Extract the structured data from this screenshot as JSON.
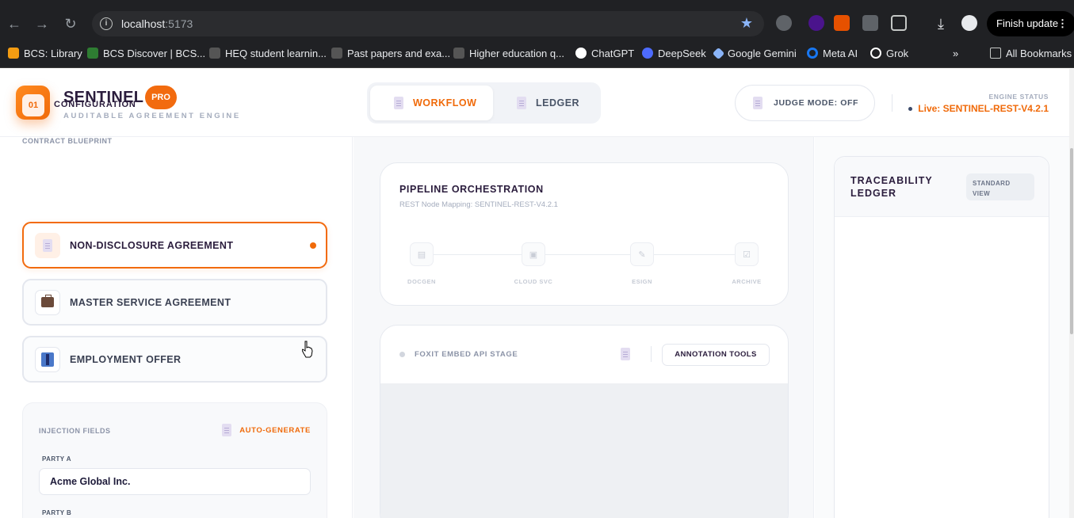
{
  "browser": {
    "url_host": "localhost",
    "url_port": ":5173",
    "finish_update_label": "Finish update",
    "bookmarks": [
      {
        "label": "BCS: Library",
        "color": "#f39c12"
      },
      {
        "label": "BCS Discover | BCS...",
        "color": "#2e7d32"
      },
      {
        "label": "HEQ student learnin...",
        "color": "#555555"
      },
      {
        "label": "Past papers and exa...",
        "color": "#555555"
      },
      {
        "label": "Higher education q...",
        "color": "#555555"
      },
      {
        "label": "ChatGPT",
        "color": "#ffffff"
      },
      {
        "label": "DeepSeek",
        "color": "#4d6bfe"
      },
      {
        "label": "Google Gemini",
        "color": "#8ab4f8"
      },
      {
        "label": "Meta AI",
        "color": "#1877f2"
      },
      {
        "label": "Grok",
        "color": "#ffffff"
      }
    ],
    "overflow_label": "»",
    "all_bookmarks_label": "All Bookmarks"
  },
  "header": {
    "brand": "SENTINEL",
    "badge": "PRO",
    "subtitle": "AUDITABLE AGREEMENT ENGINE",
    "tabs": [
      {
        "label": "WORKFLOW",
        "active": true
      },
      {
        "label": "LEDGER",
        "active": false
      }
    ],
    "judge_mode": "JUDGE MODE: OFF",
    "engine_status_label": "ENGINE STATUS",
    "engine_status_value": "Live: SENTINEL-REST-V4.2.1"
  },
  "configuration": {
    "step_number": "01",
    "step_title": "CONFIGURATION",
    "blueprint_label": "CONTRACT BLUEPRINT",
    "blueprints": [
      {
        "label": "NON-DISCLOSURE AGREEMENT",
        "selected": true,
        "icon": "document-icon"
      },
      {
        "label": "MASTER SERVICE AGREEMENT",
        "selected": false,
        "icon": "briefcase-icon"
      },
      {
        "label": "EMPLOYMENT OFFER",
        "selected": false,
        "icon": "suit-icon"
      }
    ],
    "injection": {
      "label": "INJECTION FIELDS",
      "autogen_label": "AUTO-GENERATE",
      "party_a_label": "PARTY A",
      "party_a_value": "Acme Global Inc.",
      "party_b_label": "PARTY B"
    }
  },
  "pipeline": {
    "title": "PIPELINE ORCHESTRATION",
    "subtitle": "REST Node Mapping: SENTINEL-REST-V4.2.1",
    "nodes": [
      {
        "label": "DOCGEN",
        "icon": "doc-icon"
      },
      {
        "label": "CLOUD SVC",
        "icon": "cloud-icon"
      },
      {
        "label": "ESIGN",
        "icon": "pen-icon"
      },
      {
        "label": "ARCHIVE",
        "icon": "archive-icon"
      }
    ]
  },
  "embed": {
    "title": "FOXIT EMBED API STAGE",
    "annotation_button": "ANNOTATION TOOLS"
  },
  "ledger": {
    "title": "TRACEABILITY LEDGER",
    "view_button": "STANDARD VIEW"
  },
  "colors": {
    "accent": "#f06a0a",
    "brand_dark": "#2b1d3d",
    "muted": "#a4acbd"
  }
}
